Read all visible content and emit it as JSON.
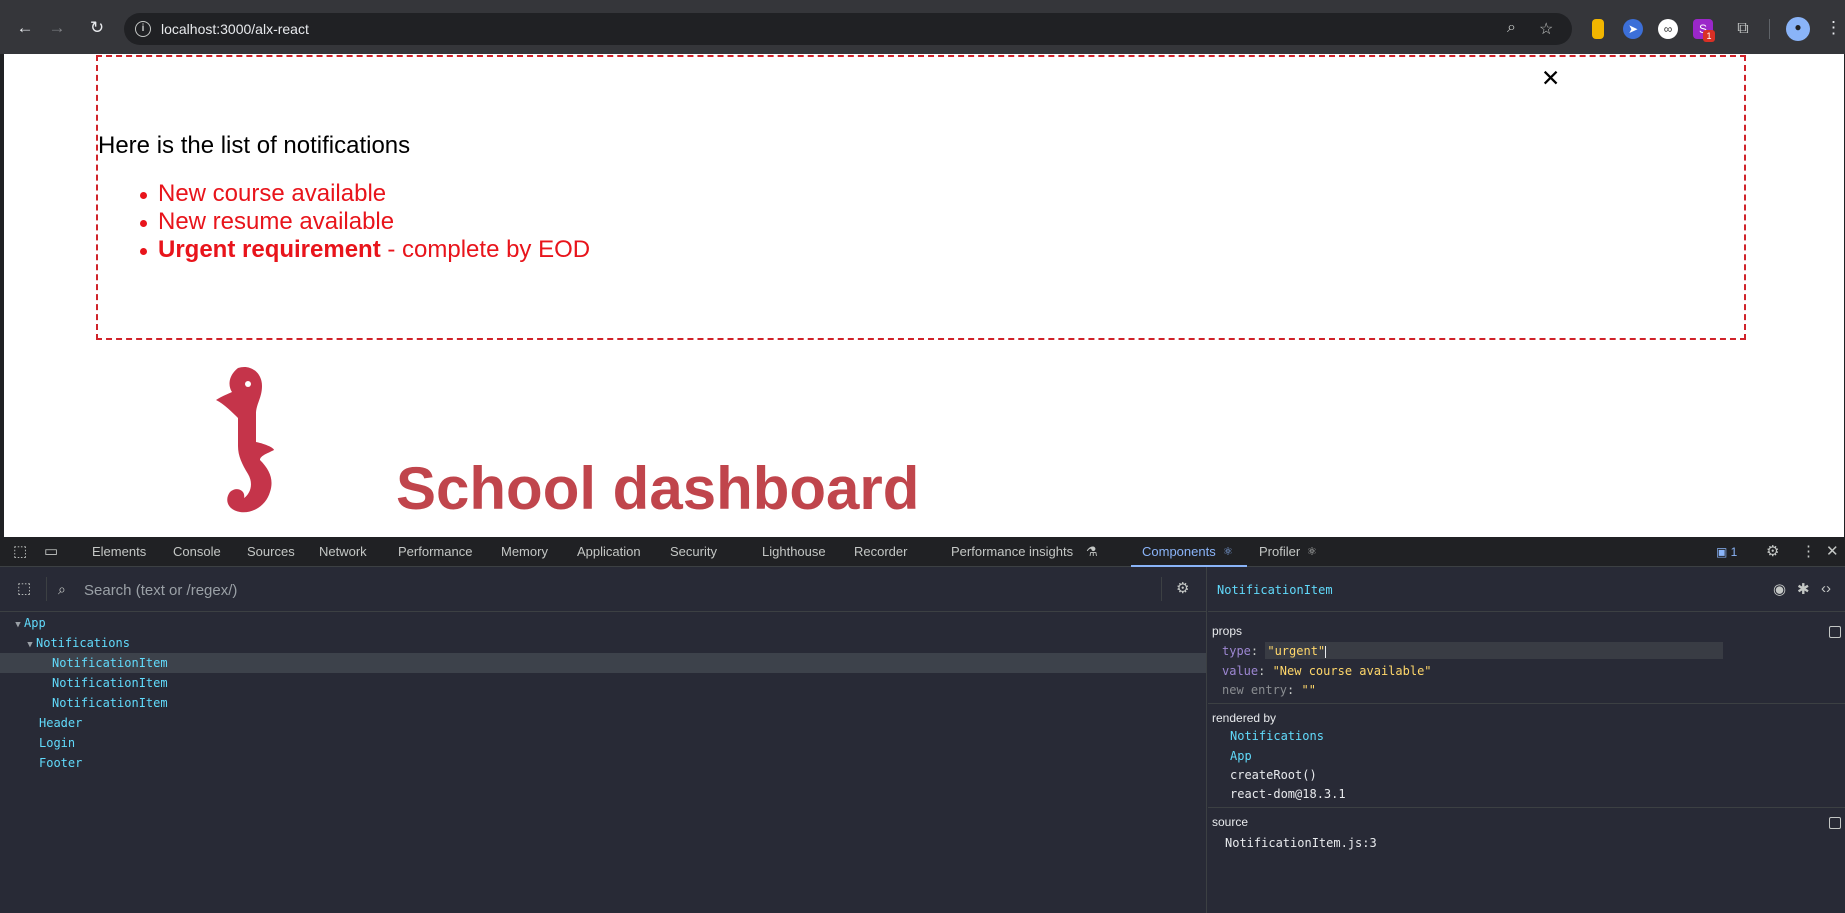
{
  "browser": {
    "url": "localhost:3000/alx-react",
    "icons": [
      "back-arrow-icon",
      "forward-arrow-icon",
      "reload-icon",
      "site-info-icon",
      "zoom-icon",
      "bookmark-star-icon",
      "extensions-icon",
      "profile-avatar",
      "menu-dots-icon"
    ],
    "extension_badge": "1"
  },
  "page": {
    "notifications": {
      "close_label": "✕",
      "title": "Here is the list of notifications",
      "items": [
        {
          "text": "New course available"
        },
        {
          "text": "New resume available"
        },
        {
          "bold": "Urgent requirement",
          "rest": " - complete by EOD"
        }
      ]
    },
    "header": {
      "title": "School dashboard"
    },
    "colors": {
      "notification_red": "#e8141b",
      "brand_red": "#c0454c",
      "panel_border": "#d0232a"
    }
  },
  "devtools": {
    "tabs": [
      "Elements",
      "Console",
      "Sources",
      "Network",
      "Performance",
      "Memory",
      "Application",
      "Security",
      "Lighthouse",
      "Recorder",
      "Performance insights",
      "Components",
      "Profiler"
    ],
    "active_tab": "Components",
    "issues_count": "1",
    "components": {
      "search_placeholder": "Search (text or /regex/)",
      "tree": [
        {
          "name": "App",
          "depth": 0,
          "expanded": true
        },
        {
          "name": "Notifications",
          "depth": 1,
          "expanded": true
        },
        {
          "name": "NotificationItem",
          "depth": 2,
          "selected": true
        },
        {
          "name": "NotificationItem",
          "depth": 2
        },
        {
          "name": "NotificationItem",
          "depth": 2
        },
        {
          "name": "Header",
          "depth": 1
        },
        {
          "name": "Login",
          "depth": 1
        },
        {
          "name": "Footer",
          "depth": 1
        }
      ]
    },
    "inspector": {
      "component": "NotificationItem",
      "props_label": "props",
      "props": [
        {
          "key": "type",
          "value": "\"urgent\""
        },
        {
          "key": "value",
          "value": "\"New course available\""
        },
        {
          "key": "new entry",
          "value": "\"\""
        }
      ],
      "rendered_by_label": "rendered by",
      "rendered_by": [
        "Notifications",
        "App",
        "createRoot()",
        "react-dom@18.3.1"
      ],
      "source_label": "source",
      "source": "NotificationItem.js:3"
    }
  }
}
